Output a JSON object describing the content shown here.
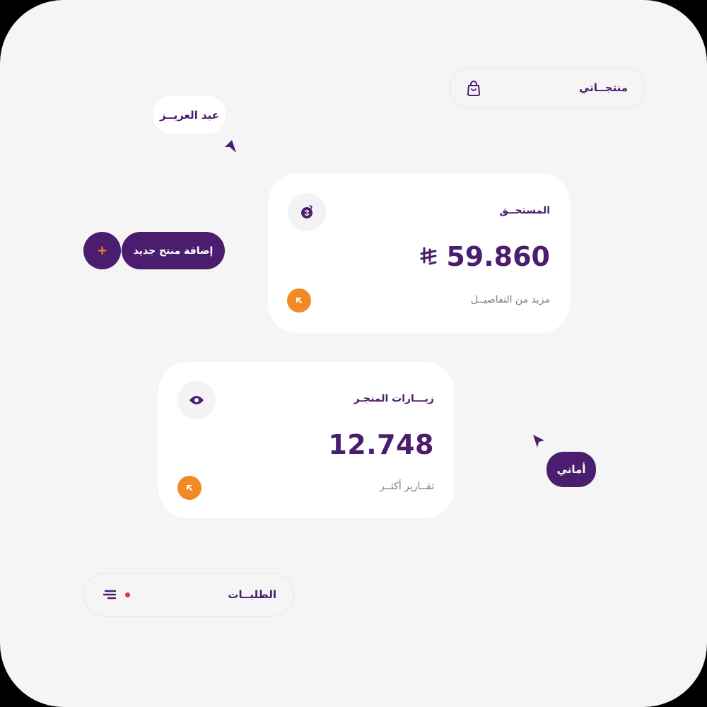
{
  "nav": {
    "products_label": "منتجــاتي",
    "orders_label": "الطلبــات"
  },
  "due_card": {
    "title": "المستحــق",
    "value": "59.860",
    "link": "مزيد من التفاصيــل"
  },
  "visits_card": {
    "title": "زيـــارات المتجـر",
    "value": "12.748",
    "link": "تقــارير أكثــر"
  },
  "add_product": {
    "label": "إضافة منتج جديد",
    "plus": "+"
  },
  "cursors": {
    "abdulaziz_label": "عبد العزيــز",
    "amani_label": "أماني"
  },
  "colors": {
    "primary": "#4b1d6e",
    "accent": "#f18a22",
    "badge": "#e53935",
    "background": "#f5f5f6",
    "card": "#ffffff"
  },
  "icons": {
    "products": "shopping-bag-icon",
    "due": "coin-icon",
    "currency": "riyal-icon",
    "visits": "eye-icon",
    "orders": "menu-lines-icon",
    "more": "arrow-up-left-icon"
  }
}
